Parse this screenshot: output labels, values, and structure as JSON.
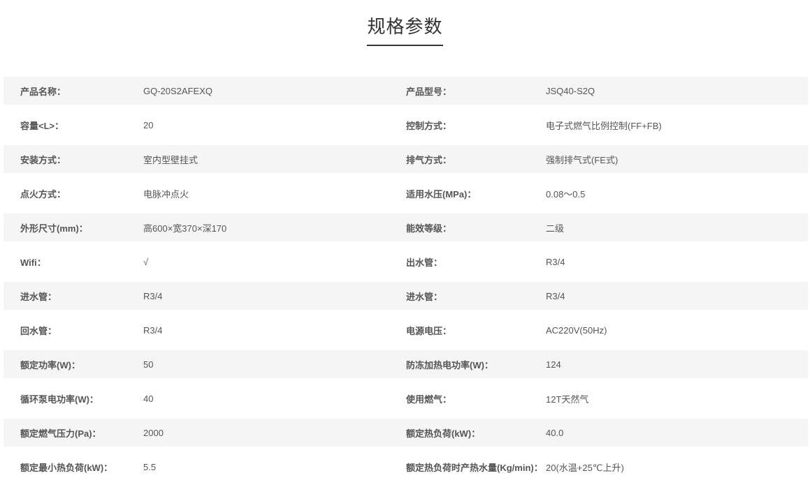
{
  "page": {
    "title": "规格参数"
  },
  "specs": [
    {
      "label_left": "产品名称：",
      "value_left": "GQ-20S2AFEXQ",
      "label_right": "产品型号：",
      "value_right": "JSQ40-S2Q"
    },
    {
      "label_left": "容量<L>：",
      "value_left": "20",
      "label_right": "控制方式：",
      "value_right": "电子式燃气比例控制(FF+FB)"
    },
    {
      "label_left": "安装方式：",
      "value_left": "室内型壁挂式",
      "label_right": "排气方式：",
      "value_right": "强制排气式(FE式)"
    },
    {
      "label_left": "点火方式：",
      "value_left": "电脉冲点火",
      "label_right": "适用水压(MPa)：",
      "value_right": "0.08～0.5"
    },
    {
      "label_left": "外形尺寸(mm)：",
      "value_left": "高600×宽370×深170",
      "label_right": "能效等级：",
      "value_right": "二级"
    },
    {
      "label_left": "Wifi：",
      "value_left": "√",
      "label_right": "出水管：",
      "value_right": "R3/4"
    },
    {
      "label_left": "进水管：",
      "value_left": "R3/4",
      "label_right": "进水管：",
      "value_right": "R3/4"
    },
    {
      "label_left": "回水管：",
      "value_left": "R3/4",
      "label_right": "电源电压：",
      "value_right": "AC220V(50Hz)"
    },
    {
      "label_left": "额定功率(W)：",
      "value_left": "50",
      "label_right": "防冻加热电功率(W)：",
      "value_right": "124"
    },
    {
      "label_left": "循环泵电功率(W)：",
      "value_left": "40",
      "label_right": "使用燃气：",
      "value_right": "12T天然气"
    },
    {
      "label_left": "额定燃气压力(Pa)：",
      "value_left": "2000",
      "label_right": "额定热负荷(kW)：",
      "value_right": "40.0"
    },
    {
      "label_left": "额定最小热负荷(kW)：",
      "value_left": "5.5",
      "label_right": "额定热负荷时产热水量(Kg/min)：",
      "value_right": "20(水温+25℃上升)"
    }
  ]
}
